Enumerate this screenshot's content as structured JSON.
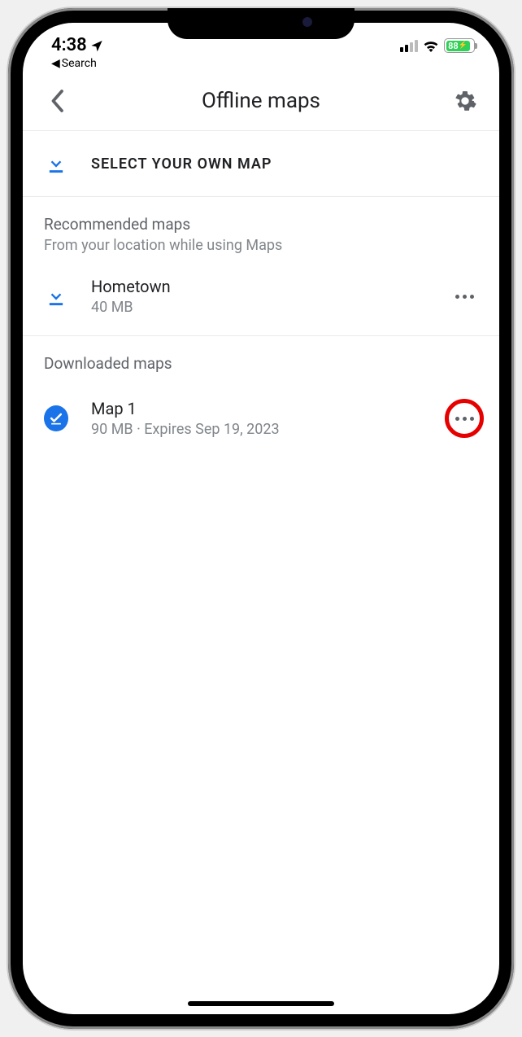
{
  "status": {
    "time": "4:38",
    "back_to": "Search",
    "battery": "88"
  },
  "header": {
    "title": "Offline maps"
  },
  "select_own": {
    "label": "SELECT YOUR OWN MAP"
  },
  "recommended": {
    "title": "Recommended maps",
    "subtitle": "From your location while using Maps",
    "items": [
      {
        "name": "Hometown",
        "meta": "40 MB"
      }
    ]
  },
  "downloaded": {
    "title": "Downloaded maps",
    "items": [
      {
        "name": "Map 1",
        "meta": "90 MB  ·  Expires Sep 19, 2023"
      }
    ]
  },
  "annotation": {
    "highlight_target": "downloaded-item-0-more"
  }
}
